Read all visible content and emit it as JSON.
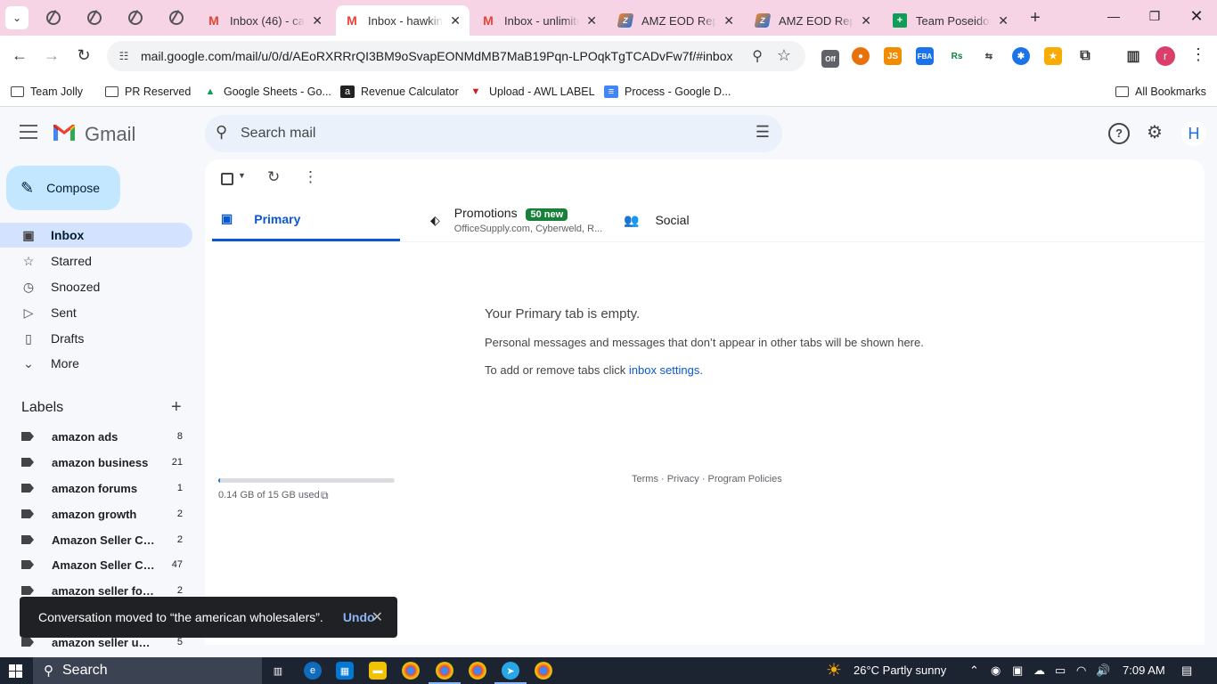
{
  "browser": {
    "tabs": [
      {
        "title": "Inbox (46) - cas",
        "icon": "gmail-icon",
        "active": false
      },
      {
        "title": "Inbox - hawkins",
        "icon": "gmail-icon",
        "active": true
      },
      {
        "title": "Inbox - unlimite",
        "icon": "gmail-icon",
        "active": false
      },
      {
        "title": "AMZ EOD Repo",
        "icon": "amz-icon",
        "active": false
      },
      {
        "title": "AMZ EOD Repo",
        "icon": "amz-icon",
        "active": false
      },
      {
        "title": "Team Poseidon",
        "icon": "sheets-icon",
        "active": false
      }
    ],
    "url": "mail.google.com/mail/u/0/d/AEoRXRRrQI3BM9oSvapEONMdMB7MaB19Pqn-LPOqkTgTCADvFw7f/#inbox",
    "profile_initial": "r",
    "bookmarks": [
      "Team Jolly",
      "PR Reserved",
      "Google Sheets - Go...",
      "Revenue Calculator",
      "Upload - AWL LABEL",
      "Process - Google D..."
    ],
    "all_bookmarks": "All Bookmarks"
  },
  "gmail": {
    "logo_text": "Gmail",
    "search_placeholder": "Search mail",
    "avatar_initial": "H",
    "compose_label": "Compose",
    "nav": [
      {
        "label": "Inbox",
        "icon": "inbox-icon",
        "active": true
      },
      {
        "label": "Starred",
        "icon": "star-icon",
        "active": false
      },
      {
        "label": "Snoozed",
        "icon": "clock-icon",
        "active": false
      },
      {
        "label": "Sent",
        "icon": "send-icon",
        "active": false
      },
      {
        "label": "Drafts",
        "icon": "draft-icon",
        "active": false
      },
      {
        "label": "More",
        "icon": "chevron-down-icon",
        "active": false
      }
    ],
    "labels_heading": "Labels",
    "labels": [
      {
        "name": "amazon ads",
        "count": "8"
      },
      {
        "name": "amazon business",
        "count": "21"
      },
      {
        "name": "amazon forums",
        "count": "1"
      },
      {
        "name": "amazon growth",
        "count": "2"
      },
      {
        "name": "Amazon Seller Cen...",
        "count": "2"
      },
      {
        "name": "Amazon Seller Ce...",
        "count": "47"
      },
      {
        "name": "amazon seller foru...",
        "count": "2"
      },
      {
        "name": "",
        "count": ""
      },
      {
        "name": "amazon seller unive",
        "count": "5"
      }
    ],
    "category_tabs": {
      "primary": "Primary",
      "promotions": "Promotions",
      "promotions_badge": "50 new",
      "promotions_senders": "OfficeSupply.com, Cyberweld, R...",
      "social": "Social"
    },
    "empty_state": {
      "title": "Your Primary tab is empty.",
      "line1": "Personal messages and messages that don’t appear in other tabs will be shown here.",
      "line2_prefix": "To add or remove tabs click ",
      "line2_link": "inbox settings",
      "line2_suffix": "."
    },
    "storage": {
      "text": "0.14 GB of 15 GB used",
      "fraction": 0.0093
    },
    "footer": "Terms · Privacy · Program Policies",
    "snackbar": {
      "message": "Conversation moved to “the american wholesalers”.",
      "action": "Undo"
    }
  },
  "taskbar": {
    "search_label": "Search",
    "weather": "26°C  Partly sunny",
    "time": "7:09 AM"
  }
}
